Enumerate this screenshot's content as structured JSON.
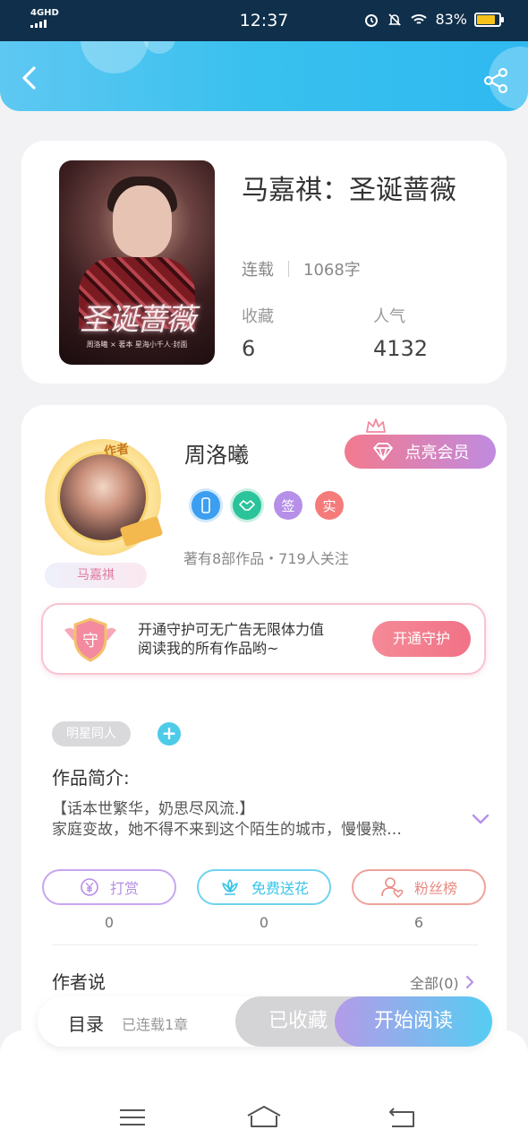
{
  "status_bar": {
    "network": "4GHD",
    "time": "12:37",
    "battery_pct": "83%",
    "battery_level": 0.83
  },
  "header": {
    "back_icon": "chevron-left-icon",
    "share_icon": "share-icon"
  },
  "book": {
    "title": "马嘉祺：圣诞蔷薇",
    "status": "连载",
    "word_count": "1068字",
    "favorites_label": "收藏",
    "favorites": "6",
    "popularity_label": "人气",
    "popularity": "4132",
    "cover": {
      "title": "圣诞蔷薇",
      "subtitle": "周洛曦 × 著本   星海小千人·封面"
    }
  },
  "author": {
    "name": "周洛曦",
    "avatar_badge": "作者",
    "avatar_tag": "马嘉祺",
    "vip_button": "点亮会员",
    "badges": [
      {
        "icon": "phone-icon",
        "color": "#3b9ef0",
        "label": ""
      },
      {
        "icon": "handshake-icon",
        "color": "#2bc39a",
        "label": ""
      },
      {
        "icon": "sign-icon",
        "color": "#b690e8",
        "label": "签"
      },
      {
        "icon": "real-name-icon",
        "color": "#f57b7b",
        "label": "实"
      }
    ],
    "works_line": "著有8部作品・719人关注"
  },
  "guard": {
    "shield_label": "守",
    "text_line1": "开通守护可无广告无限体力值",
    "text_line2": "阅读我的所有作品哟~",
    "button": "开通守护"
  },
  "tags": {
    "chip": "明星同人",
    "add": "+"
  },
  "intro": {
    "label": "作品简介:",
    "line1": "【话本世繁华，奶思尽风流.】",
    "line2": "家庭变故，她不得不来到这个陌生的城市，慢慢熟…"
  },
  "actions": [
    {
      "label": "打赏",
      "count": "0",
      "icon": "yen-icon",
      "color": "#b68ee6"
    },
    {
      "label": "免费送花",
      "count": "0",
      "icon": "flower-icon",
      "color": "#39c4e8"
    },
    {
      "label": "粉丝榜",
      "count": "6",
      "icon": "fan-icon",
      "color": "#e98a82"
    }
  ],
  "author_says": {
    "label": "作者说",
    "all_link": "全部(0)"
  },
  "read_bar": {
    "toc": "目录",
    "chapters": "已连载1章",
    "faved": "已收藏",
    "start": "开始阅读"
  },
  "nav": {
    "menu_icon": "menu-icon",
    "home_icon": "home-icon",
    "back_icon": "return-icon"
  },
  "colors": {
    "accent": "#38c0ee",
    "status_bar": "#0f2f4b",
    "vip": "#f27a8e"
  }
}
